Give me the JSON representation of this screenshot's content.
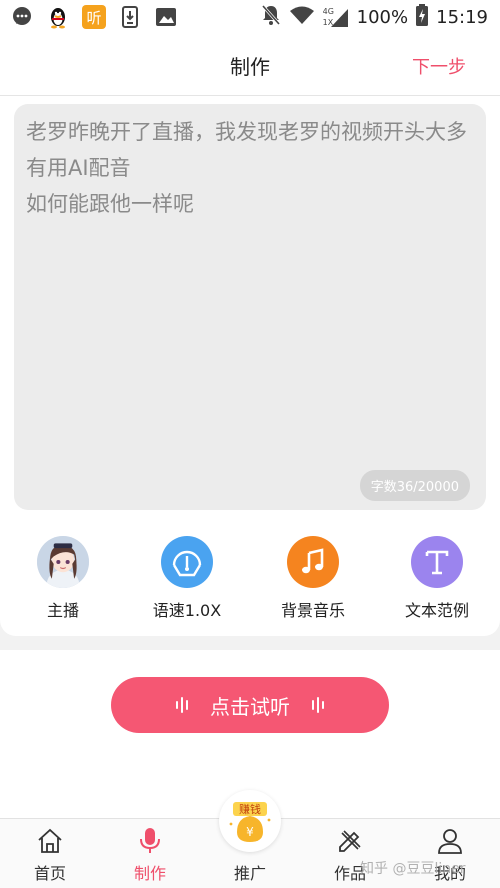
{
  "status_bar": {
    "battery": "100%",
    "time": "15:19",
    "network_top": "4G",
    "network_bottom": "1X",
    "icons": [
      "chat-icon",
      "qq-penguin-icon",
      "ting-app-icon",
      "download-icon",
      "image-icon",
      "mute-bell-icon",
      "wifi-icon",
      "signal-icon",
      "battery-charging-icon"
    ]
  },
  "header": {
    "title": "制作",
    "next_label": "下一步"
  },
  "editor": {
    "text": "老罗昨晚开了直播，我发现老罗的视频开头大多有用AI配音\n如何能跟他一样呢",
    "counter": "字数36/20000"
  },
  "tools": [
    {
      "label": "主播",
      "icon": "anchor-avatar-icon",
      "color": "#cfd8e6"
    },
    {
      "label": "语速1.0X",
      "icon": "speed-gauge-icon",
      "color": "#4aa3f0"
    },
    {
      "label": "背景音乐",
      "icon": "music-note-icon",
      "color": "#f5841f"
    },
    {
      "label": "文本范例",
      "icon": "text-t-icon",
      "color": "#9b84ee"
    }
  ],
  "listen_button": {
    "label": "点击试听"
  },
  "tabbar": {
    "tabs": [
      {
        "label": "首页",
        "icon": "home-icon"
      },
      {
        "label": "制作",
        "icon": "microphone-icon"
      },
      {
        "label": "推广",
        "icon": "money-bag-icon"
      },
      {
        "label": "作品",
        "icon": "pencil-ruler-icon"
      },
      {
        "label": "我的",
        "icon": "user-icon"
      }
    ],
    "active_index": 1,
    "promo_badge": "赚钱",
    "promo_symbol": "¥"
  },
  "watermark": "知乎 @豆豆liner",
  "colors": {
    "accent": "#ef4f6b",
    "button": "#f55773",
    "editor_bg": "#ececec"
  }
}
